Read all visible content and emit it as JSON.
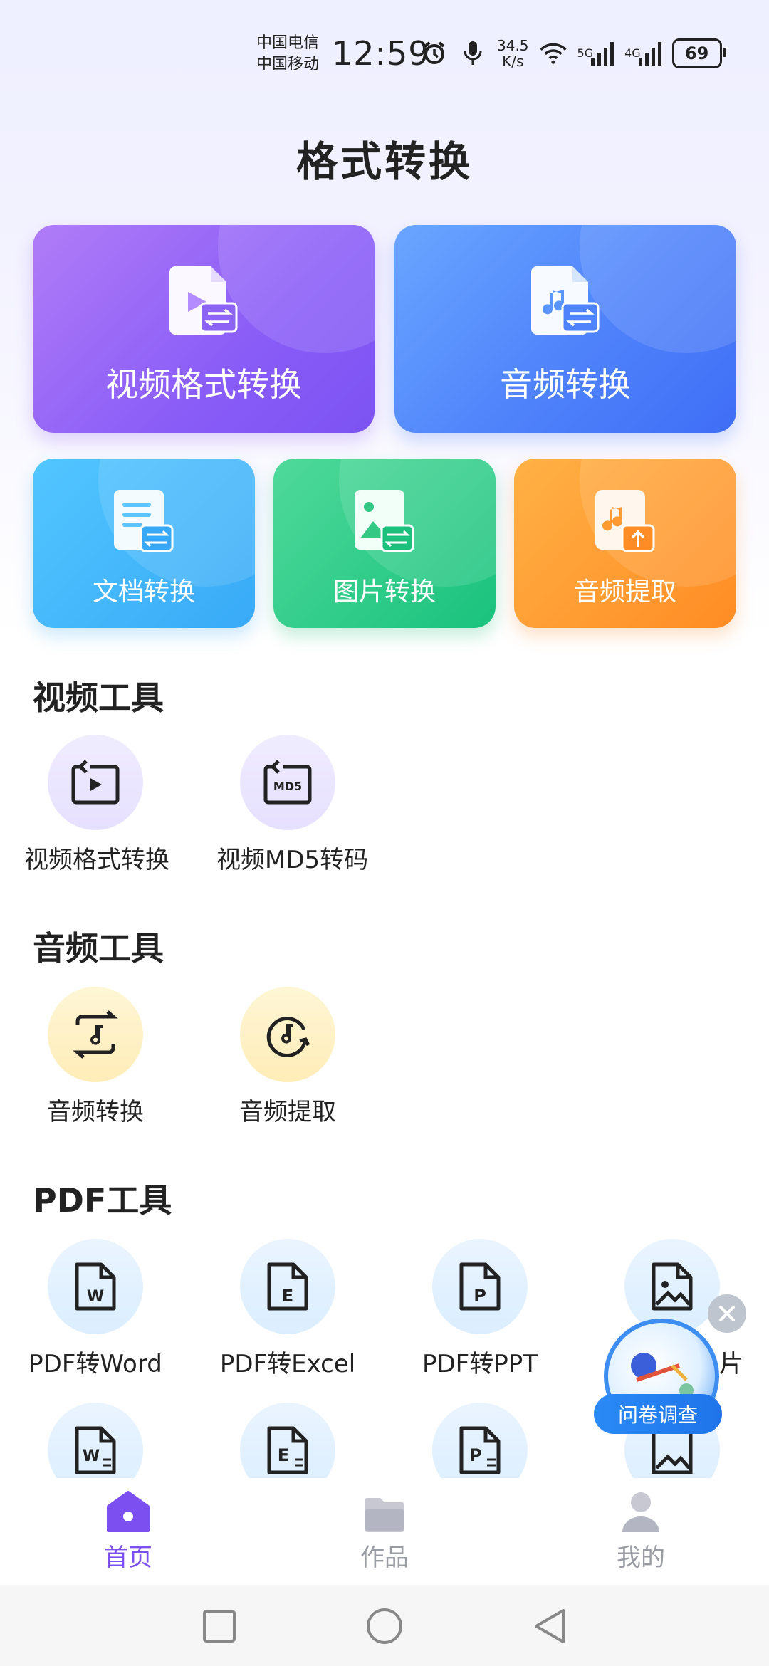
{
  "status_bar": {
    "carrier1": "中国电信",
    "carrier2": "中国移动",
    "time": "12:59",
    "speed_value": "34.5",
    "speed_unit": "K/s",
    "net1": "5G",
    "net2": "4G",
    "battery": "69"
  },
  "page_title": "格式转换",
  "cards": {
    "video": "视频格式转换",
    "audio": "音频转换",
    "doc": "文档转换",
    "image": "图片转换",
    "extract": "音频提取"
  },
  "sections": {
    "video_tools": {
      "title": "视频工具",
      "items": [
        "视频格式转换",
        "视频MD5转码"
      ]
    },
    "audio_tools": {
      "title": "音频工具",
      "items": [
        "音频转换",
        "音频提取"
      ]
    },
    "pdf_tools": {
      "title": "PDF工具",
      "items": [
        "PDF转Word",
        "PDF转Excel",
        "PDF转PPT",
        "片"
      ]
    }
  },
  "survey": {
    "label": "问卷调查"
  },
  "bottom_nav": {
    "home": "首页",
    "works": "作品",
    "mine": "我的",
    "active_color": "#7b4ff0",
    "inactive_color": "#9a9ca4"
  }
}
